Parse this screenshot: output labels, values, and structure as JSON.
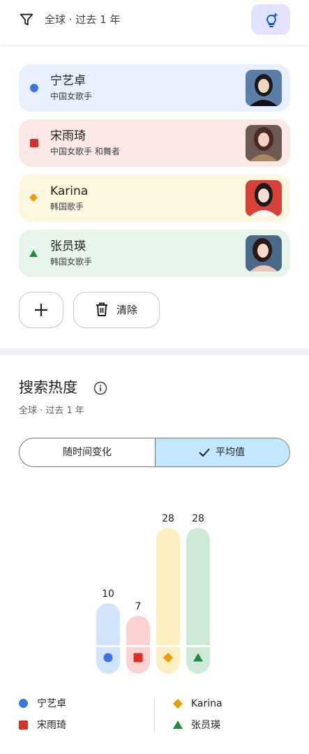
{
  "toolbar": {
    "filter_text": "全球 · 过去 1 年",
    "filter_icon": "filter-icon",
    "idea_icon": "lightbulb-sparkle-icon"
  },
  "people": [
    {
      "name": "宁艺卓",
      "desc": "中国女歌手",
      "marker": "circle",
      "color": "#3b73e0",
      "bg": "#e8f0fe"
    },
    {
      "name": "宋雨琦",
      "desc": "中国女歌手 和舞者",
      "marker": "square",
      "color": "#d93025",
      "bg": "#fce8e6"
    },
    {
      "name": "Karina",
      "desc": "韩国歌手",
      "marker": "diamond",
      "color": "#f29900",
      "bg": "#fef7e0"
    },
    {
      "name": "张员瑛",
      "desc": "韩国女歌手",
      "marker": "triangle",
      "color": "#1e8e3e",
      "bg": "#e6f4ea"
    }
  ],
  "actions": {
    "add_icon": "plus-icon",
    "clear_label": "清除",
    "clear_icon": "trash-icon"
  },
  "section": {
    "title": "搜索热度",
    "subtitle": "全球 · 过去 1 年",
    "info_icon": "info-icon"
  },
  "segments": {
    "over_time": "随时间变化",
    "average": "平均值",
    "selected": "average"
  },
  "chart_data": {
    "type": "bar",
    "categories": [
      "宁艺卓",
      "宋雨琦",
      "Karina",
      "张员瑛"
    ],
    "values": [
      10,
      7,
      28,
      28
    ],
    "ylim": [
      0,
      28
    ],
    "grid": false,
    "legend": "bottom",
    "colors": [
      "#d2e3fc",
      "#fad2cf",
      "#feefc3",
      "#ceead6"
    ],
    "marker_colors": [
      "#3b73e0",
      "#d93025",
      "#f29900",
      "#1e8e3e"
    ],
    "markers": [
      "circle",
      "square",
      "diamond",
      "triangle"
    ]
  },
  "legend": [
    {
      "label": "宁艺卓"
    },
    {
      "label": "宋雨琦"
    },
    {
      "label": "Karina"
    },
    {
      "label": "张员瑛"
    }
  ]
}
